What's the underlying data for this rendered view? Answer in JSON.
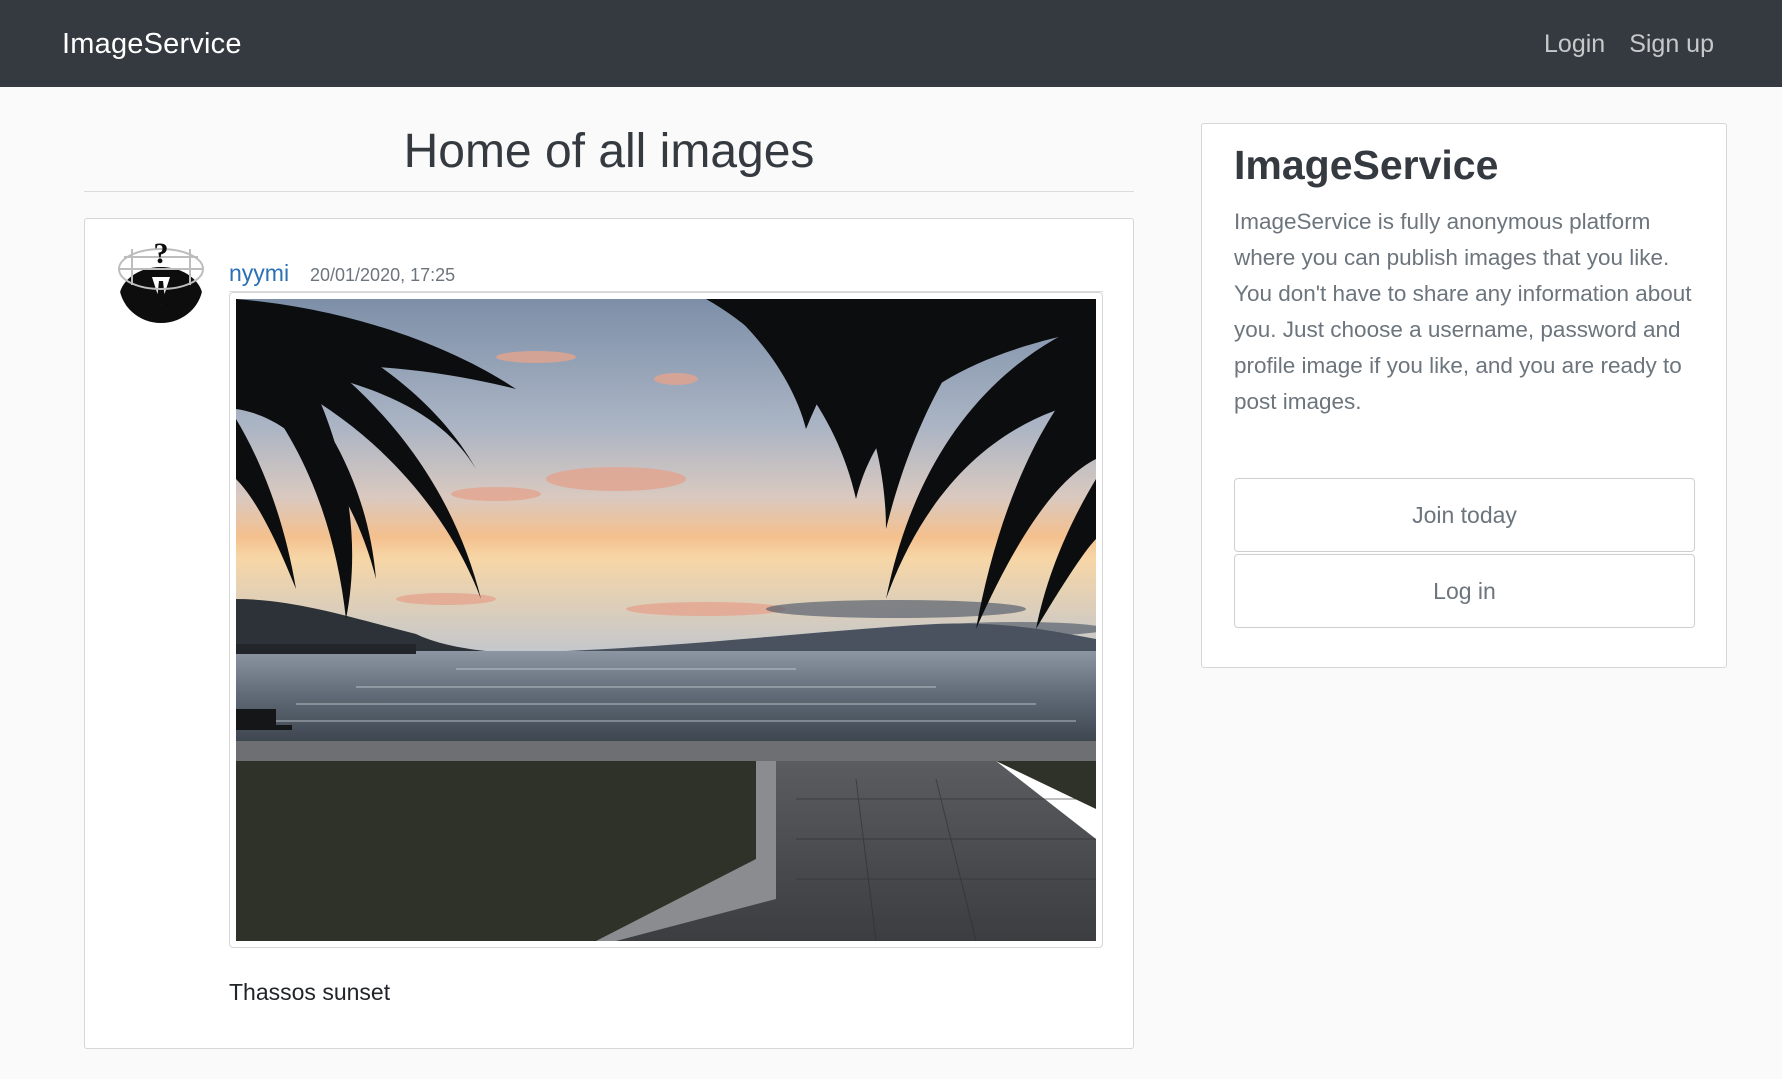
{
  "navbar": {
    "brand": "ImageService",
    "links": [
      "Login",
      "Sign up"
    ]
  },
  "main": {
    "title": "Home of all images",
    "post": {
      "author": "nyymi",
      "date": "20/01/2020, 17:25",
      "caption": "Thassos sunset",
      "avatar_icon": "anonymous-mask-icon",
      "image_subject": "sunset-over-sea-with-palm-fronds"
    }
  },
  "sidebar": {
    "title": "ImageService",
    "description": "ImageService is fully anonymous platform where you can publish images that you like. You don't have to share any information about you. Just choose a username, password and profile image if you like, and you are ready to post images.",
    "buttons": {
      "join": "Join today",
      "login": "Log in"
    }
  },
  "colors": {
    "navbar_bg": "#343a40",
    "link_blue": "#2b6fb5",
    "muted_text": "#6c757d",
    "page_bg": "#fafafa"
  }
}
